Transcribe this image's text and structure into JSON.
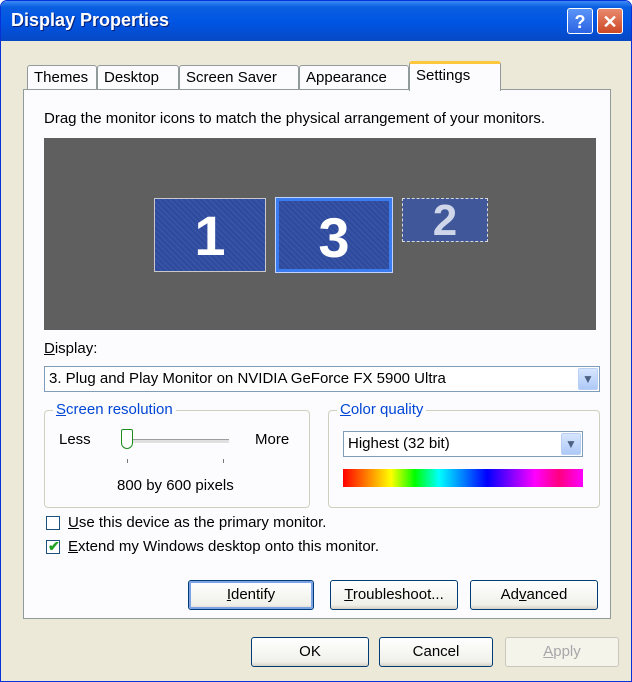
{
  "window": {
    "title": "Display Properties",
    "help_glyph": "?",
    "close_glyph": "✕"
  },
  "tabs": [
    {
      "label": "Themes"
    },
    {
      "label": "Desktop"
    },
    {
      "label": "Screen Saver"
    },
    {
      "label": "Appearance"
    },
    {
      "label": "Settings",
      "active": true
    }
  ],
  "settings": {
    "instruction": "Drag the monitor icons to match the physical arrangement of your monitors.",
    "monitors": [
      {
        "number": "1"
      },
      {
        "number": "3",
        "selected": true
      },
      {
        "number": "2",
        "inactive": true
      }
    ],
    "display_label_first": "D",
    "display_label_rest": "isplay:",
    "display_value": "3. Plug and Play Monitor on NVIDIA GeForce FX 5900 Ultra",
    "resolution": {
      "title_first": "S",
      "title_rest": "creen resolution",
      "less": "Less",
      "more": "More",
      "value_text": "800 by 600 pixels",
      "slider_level": 0
    },
    "color": {
      "title_first": "C",
      "title_rest": "olor quality",
      "value": "Highest (32 bit)"
    },
    "primary_checkbox": {
      "first": "U",
      "rest": "se this device as the primary monitor.",
      "checked": false
    },
    "extend_checkbox": {
      "first": "E",
      "rest": "xtend my Windows desktop onto this monitor.",
      "checked": true
    },
    "identify_button": {
      "first": "I",
      "rest": "dentify"
    },
    "troubleshoot_button": {
      "first": "T",
      "rest": "roubleshoot..."
    },
    "advanced_button": {
      "pre": "Ad",
      "u": "v",
      "post": "anced"
    }
  },
  "footer": {
    "ok": "OK",
    "cancel": "Cancel",
    "apply_first": "A",
    "apply_rest": "pply"
  },
  "colors": {
    "title_bar": "#0054e3",
    "monitor_fill": "#2d4a9e",
    "group_title": "#0046d5",
    "dialog_bg": "#ece9d8"
  }
}
